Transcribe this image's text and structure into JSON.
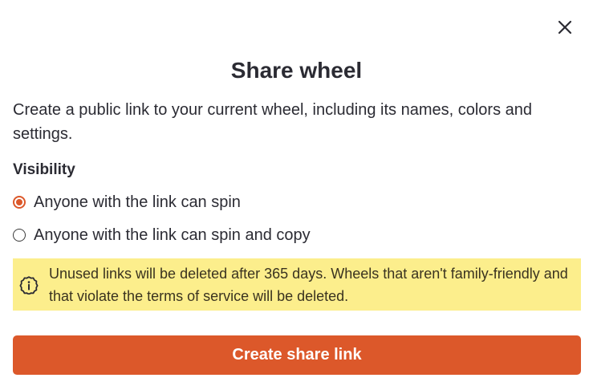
{
  "dialog": {
    "title": "Share wheel",
    "description": "Create a public link to your current wheel, including its names, colors and settings.",
    "close_icon": "close-icon"
  },
  "visibility": {
    "label": "Visibility",
    "options": [
      {
        "label": "Anyone with the link can spin",
        "checked": true
      },
      {
        "label": "Anyone with the link can spin and copy",
        "checked": false
      }
    ]
  },
  "notice": {
    "icon": "info-icon",
    "text": "Unused links will be deleted after 365 days. Wheels that aren't family-friendly and that violate the terms of service will be deleted."
  },
  "actions": {
    "create_label": "Create share link"
  },
  "colors": {
    "accent": "#dc582a",
    "notice_bg": "#fcee8c",
    "text": "#2b2b33"
  }
}
